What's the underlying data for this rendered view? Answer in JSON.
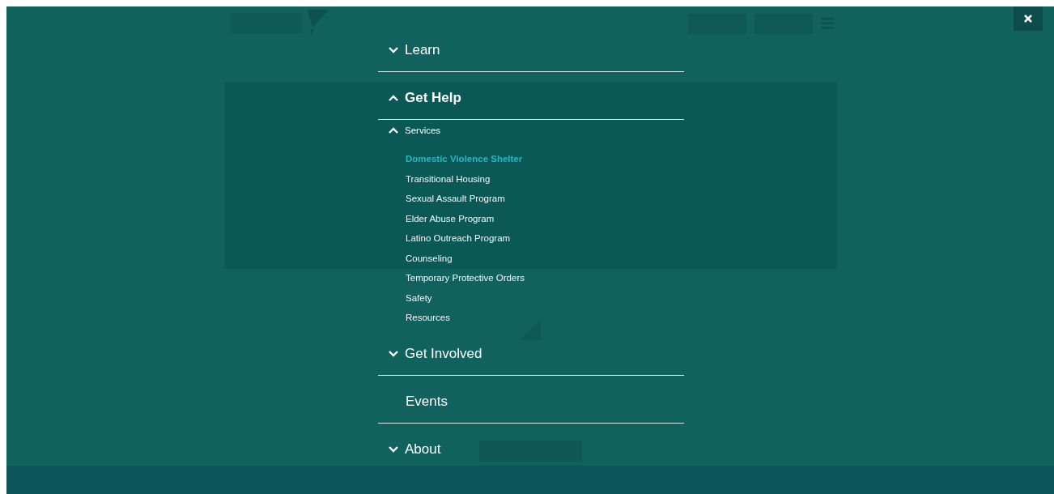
{
  "menu": {
    "items": [
      {
        "label": "Learn",
        "kind": "collapsible",
        "expanded": false
      },
      {
        "label": "Get Help",
        "kind": "collapsible",
        "expanded": true,
        "children": [
          {
            "label": "Services",
            "expanded": true,
            "children": [
              {
                "label": "Domestic Violence Shelter",
                "selected": true
              },
              {
                "label": "Transitional Housing",
                "selected": false
              },
              {
                "label": "Sexual Assault Program",
                "selected": false
              },
              {
                "label": "Elder Abuse Program",
                "selected": false
              },
              {
                "label": "Latino Outreach Program",
                "selected": false
              },
              {
                "label": "Counseling",
                "selected": false
              },
              {
                "label": "Temporary Protective Orders",
                "selected": false
              },
              {
                "label": "Safety",
                "selected": false
              },
              {
                "label": "Resources",
                "selected": false
              }
            ]
          }
        ]
      },
      {
        "label": "Get Involved",
        "kind": "collapsible",
        "expanded": false
      },
      {
        "label": "Events",
        "kind": "link"
      },
      {
        "label": "About",
        "kind": "collapsible",
        "expanded": false
      }
    ]
  }
}
